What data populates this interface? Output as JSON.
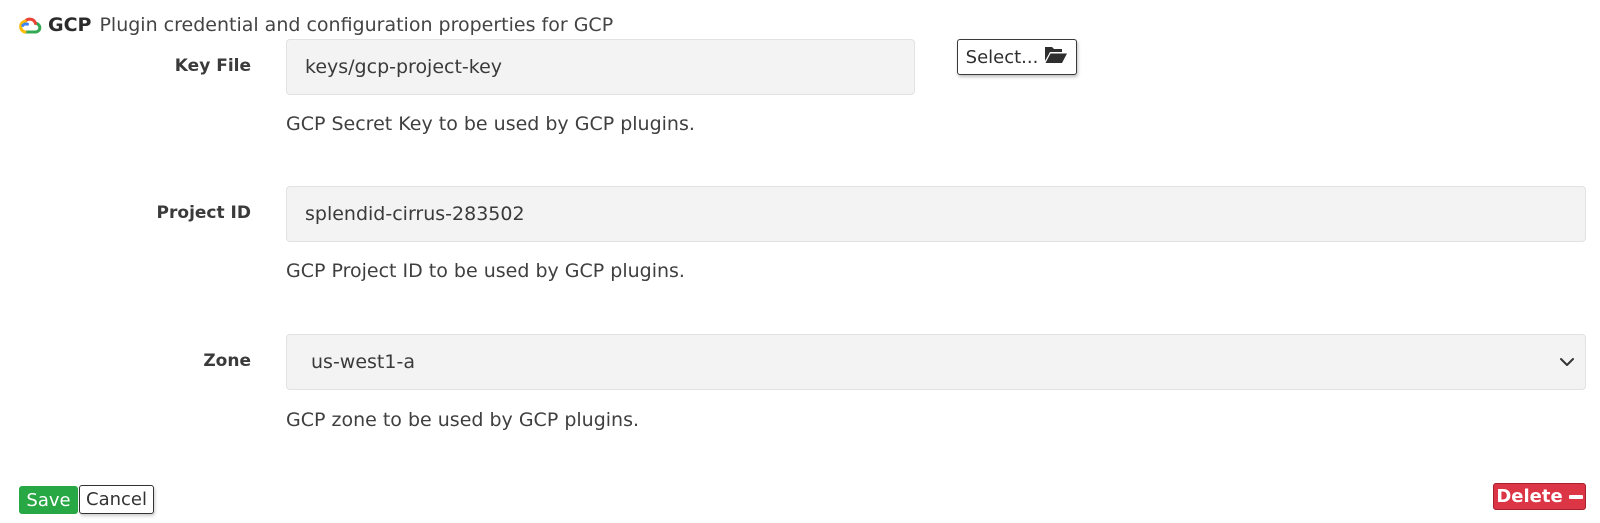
{
  "header": {
    "plugin_name": "GCP",
    "description": "Plugin credential and configuration properties for GCP",
    "logo_icon": "google-cloud-icon"
  },
  "fields": {
    "key_file": {
      "label": "Key File",
      "value": "keys/gcp-project-key",
      "help": "GCP Secret Key to be used by GCP plugins.",
      "select_button_label": "Select...",
      "select_button_icon": "folder-open-icon"
    },
    "project_id": {
      "label": "Project ID",
      "value": "splendid-cirrus-283502",
      "help": "GCP Project ID to be used by GCP plugins."
    },
    "zone": {
      "label": "Zone",
      "value": "us-west1-a",
      "help": "GCP zone to be used by GCP plugins.",
      "dropdown_icon": "chevron-down-icon"
    }
  },
  "actions": {
    "save_label": "Save",
    "cancel_label": "Cancel",
    "delete_label": "Delete",
    "delete_icon": "minus-icon"
  },
  "colors": {
    "save": "#28a745",
    "delete": "#dc3545",
    "field_bg": "#f3f3f3"
  }
}
